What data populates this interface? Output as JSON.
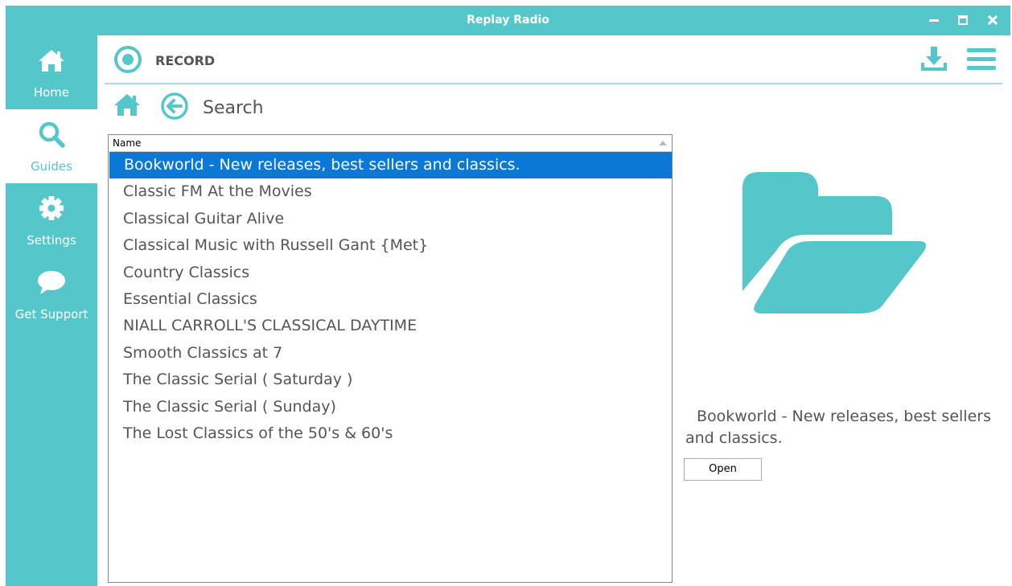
{
  "window": {
    "title": "Replay Radio",
    "minimize_icon": "minimize-icon",
    "maximize_icon": "maximize-icon",
    "close_icon": "close-icon"
  },
  "sidebar": {
    "items": [
      {
        "label": "Home",
        "icon": "home-icon",
        "active": false
      },
      {
        "label": "Guides",
        "icon": "search-icon",
        "active": true
      },
      {
        "label": "Settings",
        "icon": "gear-icon",
        "active": false
      },
      {
        "label": "Get Support",
        "icon": "chat-bubble-icon",
        "active": false
      }
    ]
  },
  "header": {
    "record_label": "RECORD",
    "record_icon": "record-icon",
    "download_icon": "download-icon",
    "menu_icon": "hamburger-menu-icon"
  },
  "breadcrumb": {
    "home_icon": "home-icon",
    "back_icon": "back-arrow-icon",
    "label": "Search"
  },
  "list": {
    "column_header": "Name",
    "selected_index": 0,
    "rows": [
      "Bookworld - New releases, best sellers and classics.",
      "Classic FM At the Movies",
      "Classical Guitar Alive",
      "Classical Music with Russell Gant {Met}",
      "Country Classics",
      "Essential Classics",
      "NIALL CARROLL'S CLASSICAL DAYTIME",
      "Smooth Classics at 7",
      "The Classic Serial ( Saturday )",
      "The Classic Serial ( Sunday)",
      "The Lost Classics of the 50's & 60's"
    ]
  },
  "detail": {
    "icon": "open-folder-icon",
    "description": "Bookworld - New releases, best sellers and classics.",
    "open_label": "Open"
  },
  "colors": {
    "accent": "#55c7cb",
    "selection": "#0a78d6",
    "text": "#555555"
  }
}
